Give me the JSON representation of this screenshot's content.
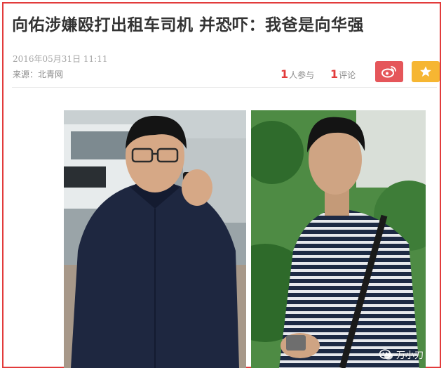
{
  "article": {
    "title": "向佑涉嫌殴打出租车司机 并恐吓：我爸是向华强",
    "date": "2016年05月31日 11:11",
    "source": "来源：北青网",
    "join_count": "1",
    "join_label": "人参与",
    "comment_count": "1",
    "comment_label": "评论"
  },
  "share": {
    "weibo_icon": "weibo-icon",
    "favorite_icon": "star-icon"
  },
  "colors": {
    "accent_red": "#e23b3b",
    "weibo_red": "#e5565a",
    "favorite_yellow": "#f6b632"
  },
  "watermark": {
    "text": "万小刀",
    "icon": "wechat-icon"
  }
}
